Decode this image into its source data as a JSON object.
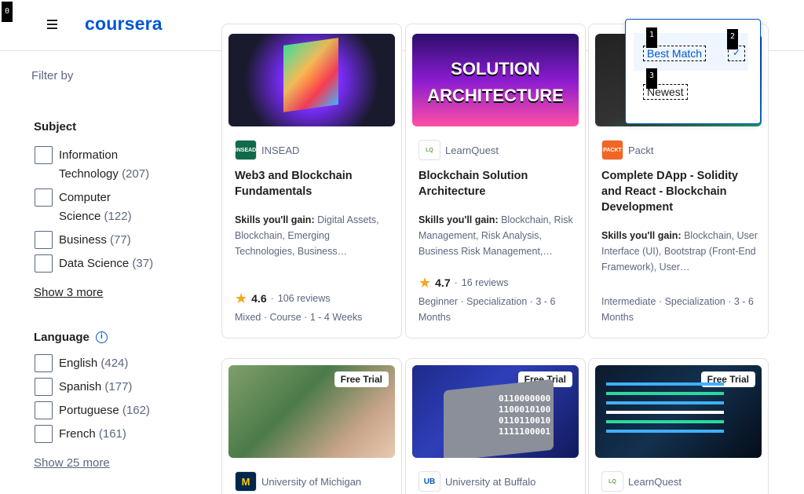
{
  "corner_badge": "0",
  "header": {
    "logo": "coursera"
  },
  "sidebar": {
    "filter_by": "Filter by",
    "subject": {
      "title": "Subject",
      "items": [
        {
          "label_line1": "Information",
          "label_line2": "Technology",
          "count": "(207)"
        },
        {
          "label_line1": "Computer",
          "label_line2": "Science",
          "count": "(122)"
        },
        {
          "label": "Business",
          "count": "(77)"
        },
        {
          "label": "Data Science",
          "count": "(37)"
        }
      ],
      "show_more": "Show 3 more"
    },
    "language": {
      "title": "Language",
      "items": [
        {
          "label": "English",
          "count": "(424)"
        },
        {
          "label": "Spanish",
          "count": "(177)"
        },
        {
          "label": "Portuguese",
          "count": "(162)"
        },
        {
          "label": "French",
          "count": "(161)"
        }
      ],
      "show_more": "Show 25 more"
    }
  },
  "sort_menu": {
    "options": [
      "Best Match",
      "Newest"
    ],
    "tags": [
      "1",
      "2",
      "3"
    ]
  },
  "cards": [
    {
      "partner": "INSEAD",
      "partner_logo": "INSEAD",
      "title": "Web3 and Blockchain Fundamentals",
      "skills_label": "Skills you'll gain:",
      "skills": "Digital Assets, Blockchain, Emerging Technologies, Business…",
      "rating": "4.6",
      "reviews": "106 reviews",
      "meta": "Mixed · Course · 1 - 4 Weeks"
    },
    {
      "partner": "LearnQuest",
      "partner_logo": "LearnQuest",
      "thumb_text_1": "SOLUTION",
      "thumb_text_2": "ARCHITECTURE",
      "title": "Blockchain Solution Architecture",
      "skills_label": "Skills you'll gain:",
      "skills": "Blockchain, Risk Management, Risk Analysis, Business Risk Management,…",
      "rating": "4.7",
      "reviews": "16 reviews",
      "meta": "Beginner · Specialization · 3 - 6 Months"
    },
    {
      "partner": "Packt",
      "partner_logo": "PACKT",
      "title": "Complete DApp - Solidity and React - Blockchain Development",
      "skills_label": "Skills you'll gain:",
      "skills": "Blockchain, User Interface (UI), Bootstrap (Front-End Framework), User…",
      "meta": "Intermediate · Specialization · 3 - 6 Months"
    },
    {
      "badge": "Free Trial",
      "partner": "University of Michigan",
      "partner_logo": "M"
    },
    {
      "badge": "Free Trial",
      "partner": "University at Buffalo",
      "partner_logo": "UB",
      "thumb_digits": "0110000000\n1100010100\n0110110010\n1111100001"
    },
    {
      "badge": "Free Trial",
      "partner": "LearnQuest",
      "partner_logo": "LearnQuest"
    }
  ]
}
